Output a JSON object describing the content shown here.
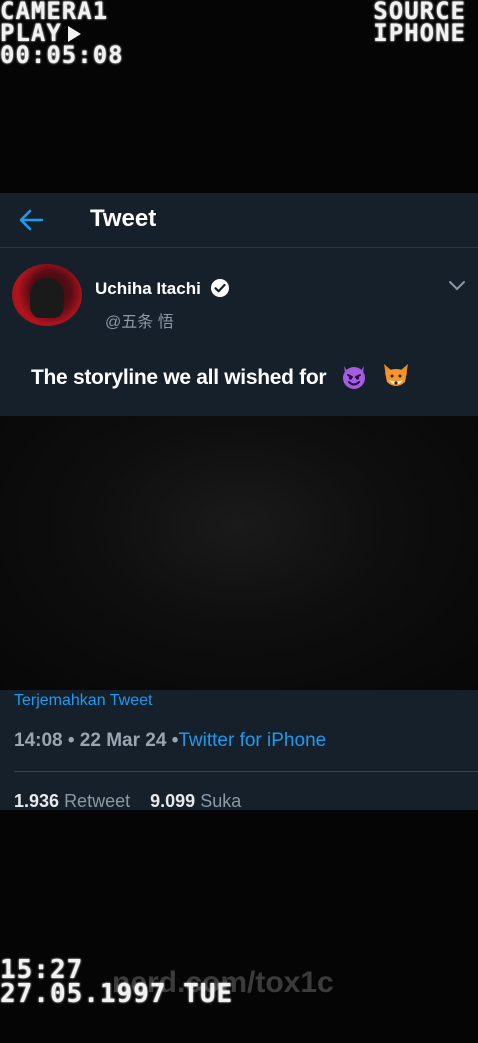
{
  "vhs": {
    "camera": "CAMERA1",
    "play": "PLAY",
    "counter": "00:05:08",
    "source": "SOURCE",
    "device": "IPHONE",
    "clock": "15:27",
    "date": "27.05.1997 TUE"
  },
  "watermark": "nerd.com/tox1c",
  "header": {
    "title": "Tweet"
  },
  "tweet": {
    "name": "Uchiha Itachi",
    "handle": "@五条 悟",
    "text": "The storyline we all wished for",
    "emojis": [
      "smiling-devil",
      "fox-face"
    ]
  },
  "meta": {
    "translate": "Terjemahkan Tweet",
    "time": "14:08 • 22 Mar 24 •",
    "source": "Twitter for iPhone",
    "retweets": "1.936",
    "retweets_label": "Retweet",
    "likes": "9.099",
    "likes_label": "Suka"
  },
  "colors": {
    "panel": "#15202b",
    "accent": "#1d9bf0",
    "muted": "#8b98a5"
  }
}
